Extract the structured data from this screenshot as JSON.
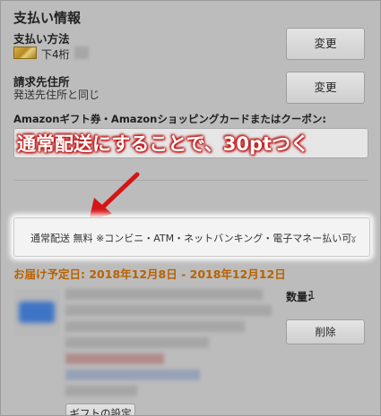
{
  "payment": {
    "section_title": "支払い情報",
    "method_label": "支払い方法",
    "card_last4_label": "下4桁",
    "change_label": "変更",
    "billing_label": "請求先住所",
    "billing_value": "発送先住所と同じ",
    "coupon_label": "Amazonギフト券・Amazonショッピングカードまたはクーポン:"
  },
  "annotation": {
    "callout": "通常配送にすることで、30ptつく"
  },
  "shipping": {
    "selected": "通常配送 無料 ※コンビニ・ATM・ネットバンキング・電子マネー払い可。"
  },
  "delivery": {
    "date_label": "お届け予定日: 2018年12月8日 - 2018年12月12日"
  },
  "item": {
    "quantity_label": "数量:",
    "quantity_value": "1",
    "delete_label": "削除",
    "gift_label": "ギフトの設定"
  },
  "colors": {
    "callout_red": "#c41b1b",
    "delivery_orange": "#b86200",
    "overlay_gray": "#bcbcbc"
  }
}
